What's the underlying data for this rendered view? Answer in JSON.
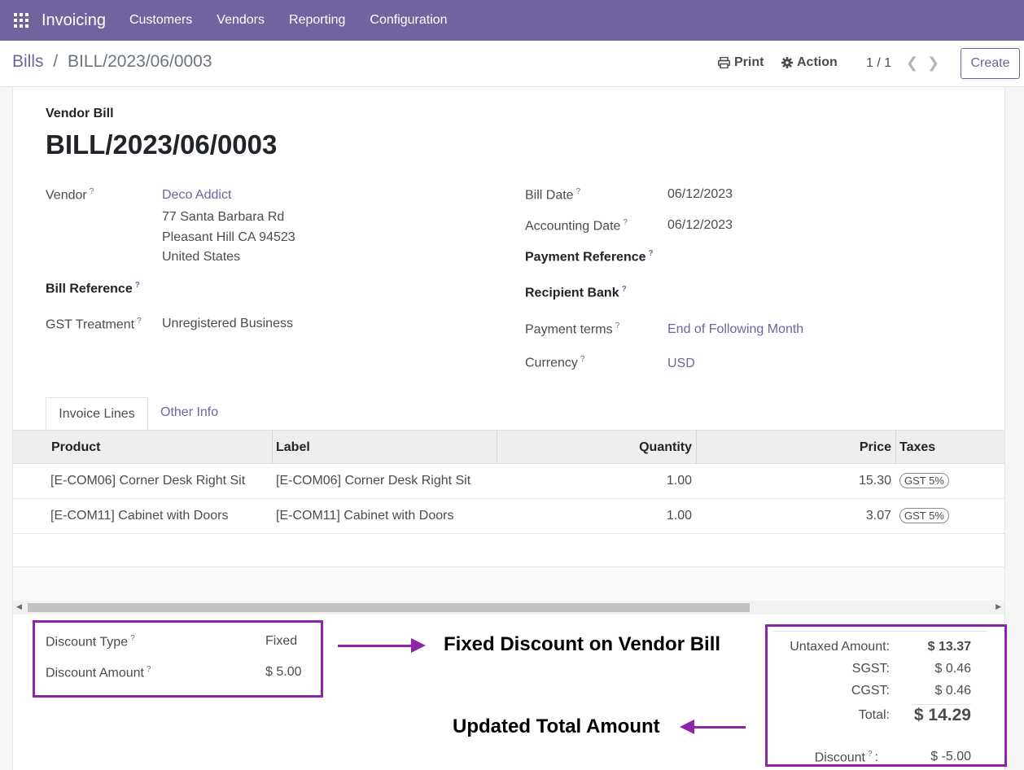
{
  "nav": {
    "app_name": "Invoicing",
    "items": [
      "Customers",
      "Vendors",
      "Reporting",
      "Configuration"
    ]
  },
  "control": {
    "breadcrumb_parent": "Bills",
    "breadcrumb_sep": "/",
    "breadcrumb_current": "BILL/2023/06/0003",
    "print_label": "Print",
    "action_label": "Action",
    "pager": "1 / 1",
    "create_label": "Create"
  },
  "form": {
    "subtitle": "Vendor Bill",
    "title": "BILL/2023/06/0003",
    "vendor_label": "Vendor",
    "vendor_name": "Deco Addict",
    "vendor_address": [
      "77 Santa Barbara Rd",
      "Pleasant Hill CA 94523",
      "United States"
    ],
    "bill_reference_label": "Bill Reference",
    "gst_treatment_label": "GST Treatment",
    "gst_treatment_value": "Unregistered Business",
    "bill_date_label": "Bill Date",
    "bill_date_value": "06/12/2023",
    "accounting_date_label": "Accounting Date",
    "accounting_date_value": "06/12/2023",
    "payment_reference_label": "Payment Reference",
    "recipient_bank_label": "Recipient Bank",
    "payment_terms_label": "Payment terms",
    "payment_terms_value": "End of Following Month",
    "currency_label": "Currency",
    "currency_value": "USD",
    "help_mark": "?"
  },
  "tabs": [
    "Invoice Lines",
    "Other Info"
  ],
  "table": {
    "headers": [
      "Product",
      "Label",
      "Quantity",
      "Price",
      "Taxes"
    ],
    "rows": [
      {
        "product": "[E-COM06] Corner Desk Right Sit",
        "label": "[E-COM06] Corner Desk Right Sit",
        "quantity": "1.00",
        "price": "15.30",
        "tax": "GST 5%"
      },
      {
        "product": "[E-COM11] Cabinet with Doors",
        "label": "[E-COM11] Cabinet with Doors",
        "quantity": "1.00",
        "price": "3.07",
        "tax": "GST 5%"
      }
    ]
  },
  "discount": {
    "type_label": "Discount Type",
    "type_value": "Fixed",
    "amount_label": "Discount Amount",
    "amount_value": "$ 5.00"
  },
  "totals": {
    "untaxed_label": "Untaxed Amount:",
    "untaxed_value": "$ 13.37",
    "sgst_label": "SGST:",
    "sgst_value": "$ 0.46",
    "cgst_label": "CGST:",
    "cgst_value": "$ 0.46",
    "total_label": "Total:",
    "total_value": "$ 14.29",
    "discount_label": "Discount",
    "discount_colon": ":",
    "discount_value": "$ -5.00"
  },
  "annotations": {
    "fixed_discount": "Fixed Discount on Vendor Bill",
    "updated_total": "Updated Total Amount"
  },
  "colors": {
    "brand": "#71639e",
    "annotation": "#8e24aa"
  }
}
